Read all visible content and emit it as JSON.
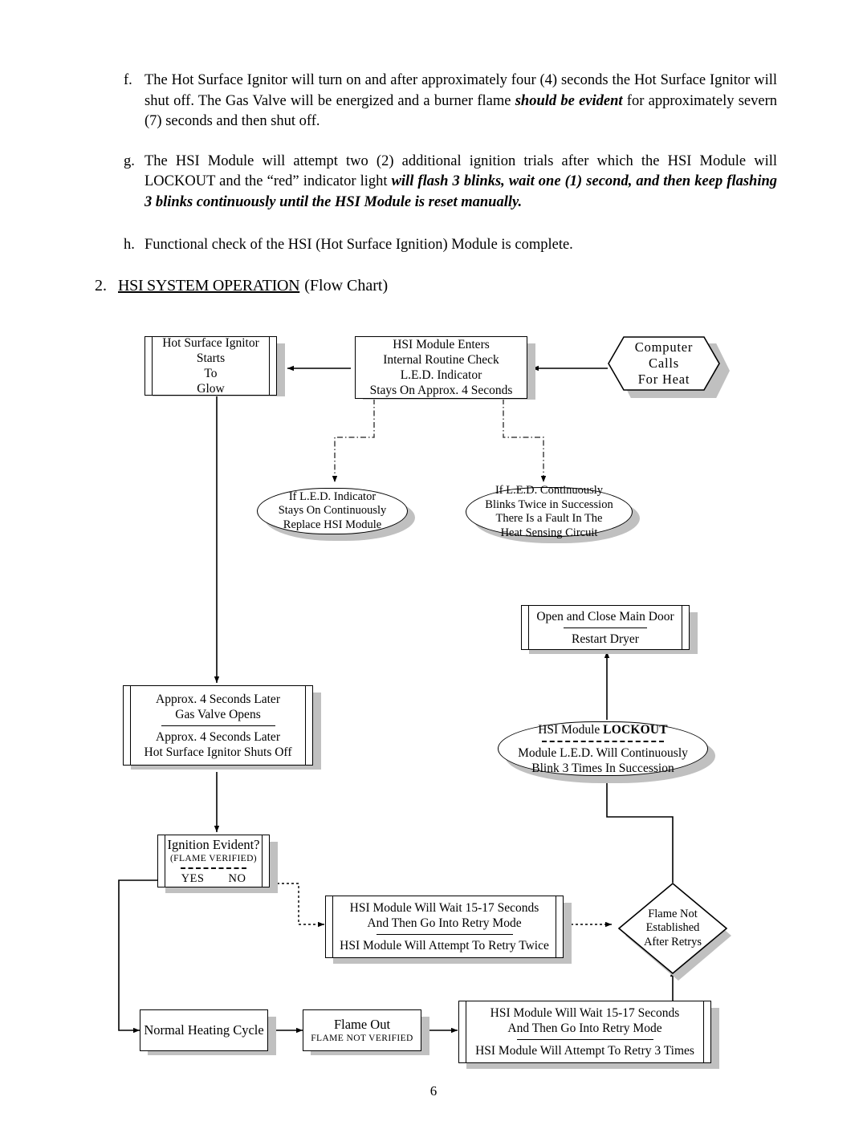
{
  "page": {
    "number": "6"
  },
  "prose": [
    {
      "marker": "f.",
      "runs": [
        {
          "text": "The Hot Surface Ignitor will turn on and after approximately four (4) seconds the Hot Surface Ignitor will shut off.  The Gas Valve will be energized and a burner flame ",
          "style": "normal"
        },
        {
          "text": "should be evident",
          "style": "bold-italic"
        },
        {
          "text": " for approximately severn (7) seconds and then shut off.",
          "style": "normal"
        }
      ]
    },
    {
      "marker": "g.",
      "runs": [
        {
          "text": "The HSI Module will attempt two (2) additional ignition trials after which the HSI Module will LOCKOUT and the “red” indicator light ",
          "style": "normal"
        },
        {
          "text": "will flash 3 blinks, wait one (1) second, and then keep flashing 3 blinks continuously until the HSI Module is reset manually.",
          "style": "bold-italic"
        }
      ]
    },
    {
      "marker": "h.",
      "runs": [
        {
          "text": "Functional check of the HSI (Hot Surface Ignition) Module is complete.",
          "style": "normal"
        }
      ]
    }
  ],
  "section_heading": {
    "number": "2.",
    "underlined": "HSI SYSTEM OPERATION",
    "tail": "(Flow Chart)"
  },
  "flowchart": {
    "title": "HSI SYSTEM OPERATION Flow Chart",
    "nodes": {
      "computer_calls": {
        "shape": "preparation-hexagon",
        "lines": [
          "Computer",
          "Calls",
          "For Heat"
        ]
      },
      "module_enters": {
        "shape": "process",
        "lines": [
          "HSI Module Enters",
          "Internal Routine Check",
          "L.E.D. Indicator",
          "Stays On Approx. 4 Seconds"
        ]
      },
      "ignitor_glow": {
        "shape": "predefined-process",
        "lines": [
          "Hot Surface Ignitor",
          "Starts",
          "To",
          "Glow"
        ]
      },
      "led_stays_on": {
        "shape": "terminator",
        "lines": [
          "If L.E.D. Indicator",
          "Stays On Continuously",
          "Replace HSI Module"
        ]
      },
      "led_blinks_twice": {
        "shape": "terminator",
        "lines": [
          "If L.E.D. Continuously",
          "Blinks Twice in Succession",
          "There Is a Fault In The",
          "Heat Sensing Circuit"
        ]
      },
      "open_close_door": {
        "shape": "predefined-process",
        "top_lines": [
          "Open and Close Main Door"
        ],
        "bottom_lines": [
          "Restart Dryer"
        ]
      },
      "lockout": {
        "shape": "terminator",
        "title_prefix": "HSI Module ",
        "title_bold": "LOCKOUT",
        "bottom_lines": [
          "Module L.E.D. Will Continuously",
          "Blink 3 Times In Succession"
        ]
      },
      "gas_valve_opens": {
        "shape": "predefined-process",
        "top_lines": [
          "Approx. 4 Seconds Later",
          "Gas Valve Opens"
        ],
        "bottom_lines": [
          "Approx. 4 Seconds Later",
          "Hot Surface Ignitor Shuts Off"
        ]
      },
      "ignition_evident": {
        "shape": "predefined-process",
        "title": "Ignition Evident?",
        "subtitle": "(FLAME VERIFIED)",
        "yes_label": "YES",
        "no_label": "NO"
      },
      "retry_twice": {
        "shape": "predefined-process",
        "top_lines": [
          "HSI Module Will Wait 15-17 Seconds",
          "And Then Go Into Retry Mode"
        ],
        "bottom_lines": [
          "HSI Module Will Attempt To Retry Twice"
        ]
      },
      "flame_not_established": {
        "shape": "decision-diamond",
        "lines": [
          "Flame Not",
          "Established",
          "After Retrys"
        ]
      },
      "normal_heating": {
        "shape": "process",
        "lines": [
          "Normal Heating Cycle"
        ]
      },
      "flame_out": {
        "shape": "process",
        "title": "Flame Out",
        "subtitle": "FLAME NOT VERIFIED"
      },
      "retry_3_times": {
        "shape": "predefined-process",
        "top_lines": [
          "HSI Module Will Wait 15-17 Seconds",
          "And Then Go Into Retry Mode"
        ],
        "bottom_lines": [
          "HSI Module Will Attempt To Retry 3 Times"
        ]
      }
    },
    "colors": {
      "stroke": "#000000",
      "shadow": "#c0c0c0",
      "fill": "#ffffff"
    }
  }
}
